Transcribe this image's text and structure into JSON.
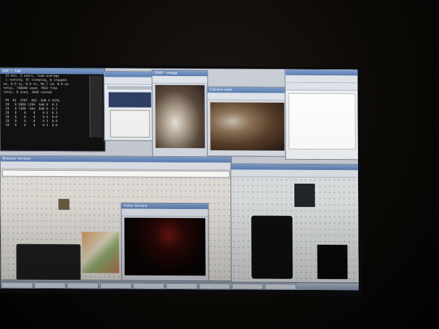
{
  "photo": {
    "subject": "monitor-photo",
    "screen": {
      "terminal": {
        "title": "ssh - top",
        "lines": [
          "  15 min, 3 users, load average",
          "  1 running, 97 sleeping, 0 stopped",
          " us, 0.0 sy, 0.0 ni, 96.7 id, 0.0 wa",
          " total, 748840 used, 7052 free",
          " total, 0 used, 1948 cached",
          "",
          "  PR  NI  VIRT  RES  SHR S %CPU",
          "  20   0 3080 1296  940 R  0.3",
          "  20   0 1300  944  840 S  0.3",
          "  20   0    0    0    0 S  0.3",
          "  20   0    0    0    0 S  0.0",
          "  20   0    0    0    0 S  0.0",
          "  20   0    0    0    0 S  0.0"
        ]
      },
      "camera_windows": [
        {
          "title": "GIMP - image"
        },
        {
          "title": "Camera view"
        }
      ],
      "browser": {
        "title": "Browser window"
      },
      "dark_window": {
        "title": "Video window"
      },
      "taskbar_items": 9
    }
  }
}
